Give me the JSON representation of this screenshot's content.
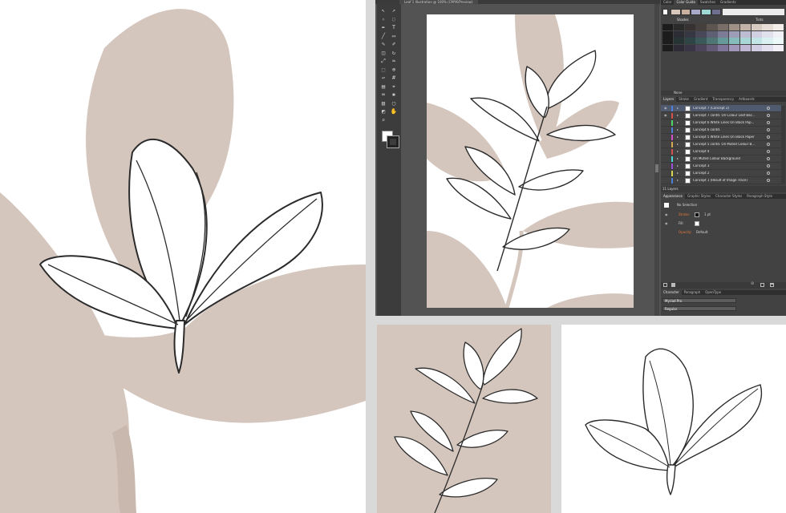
{
  "colors": {
    "beige": "#d5c6bd",
    "line": "#2b2b2b",
    "panel_bg": "#424242",
    "canvas_bg": "#535353",
    "selected_row": "#4f5a6e",
    "stroke_label": "#e07a3a"
  },
  "illustrator": {
    "document_tab": "Leaf 1 Illustration @ 100% (CMYK/Preview)",
    "tools": [
      "selection-tool",
      "direct-selection-tool",
      "magic-wand-tool",
      "lasso-tool",
      "pen-tool",
      "type-tool",
      "line-tool",
      "rectangle-tool",
      "paintbrush-tool",
      "pencil-tool",
      "eraser-tool",
      "rotate-tool",
      "scale-tool",
      "width-tool",
      "free-transform-tool",
      "shape-builder-tool",
      "perspective-tool",
      "mesh-tool",
      "gradient-tool",
      "eyedropper-tool",
      "blend-tool",
      "symbol-sprayer-tool",
      "column-graph-tool",
      "artboard-tool",
      "slice-tool",
      "hand-tool",
      "zoom-tool"
    ]
  },
  "color_guide": {
    "tabs": [
      "Color",
      "Color Guide",
      "Swatches",
      "Gradients"
    ],
    "active_tab": "Color Guide",
    "shades_label": "Shades",
    "tints_label": "Tints",
    "footer_label": "None",
    "strip_colors": [
      "#ffffff",
      "#d7c7bd",
      "#c9b09f",
      "#a9a9c9",
      "#9fd6d6",
      "#6f6f8f"
    ],
    "grid_columns": [
      "#3d3d3d",
      "#4a4543",
      "#5a524e",
      "#6b625c",
      "#8a7f77",
      "#a89e96",
      "#c7bdb5",
      "#d9d0c9",
      "#e6dfd9",
      "#f0ebe7"
    ],
    "grid_rows": [
      [
        "#2a2a2a",
        "#353231",
        "#45403d",
        "#5d5550",
        "#7a6f68",
        "#a09186",
        "#c2b3a8",
        "#d7cac1",
        "#e6ddd6",
        "#f3eee9"
      ],
      [
        "#2c2c34",
        "#373744",
        "#484858",
        "#5f5f74",
        "#7c7c96",
        "#9d9db7",
        "#bcbcd2",
        "#d0d0e2",
        "#e1e1ee",
        "#f0f0f7"
      ],
      [
        "#263434",
        "#2f4444",
        "#3c5959",
        "#4f7575",
        "#669999",
        "#86bcbc",
        "#a9d6d6",
        "#c4e5e5",
        "#dbf0f0",
        "#edf8f8"
      ],
      [
        "#2e2a36",
        "#3a3546",
        "#4b445b",
        "#625a77",
        "#7f759a",
        "#a097bb",
        "#bfb7d4",
        "#d3cde3",
        "#e4dfef",
        "#f2eff7"
      ]
    ]
  },
  "layers": {
    "tabs": [
      "Layers",
      "Stroke",
      "Gradient",
      "Transparency",
      "Artboards"
    ],
    "active_tab": "Layers",
    "items": [
      {
        "name": "Concept 7 (Concept 2)",
        "color": "#4f7fd6",
        "selected": true
      },
      {
        "name": "Concept 7 contd. On Colour Leaf Bac...",
        "color": "#d64f4f",
        "selected": false
      },
      {
        "name": "Concept 6 White Lines On Black Pap...",
        "color": "#4fd66a",
        "selected": false
      },
      {
        "name": "Concept 6 contd.",
        "color": "#4f7fd6",
        "selected": false
      },
      {
        "name": "Concept 5 White Lines On Black Paper",
        "color": "#d64fc9",
        "selected": false
      },
      {
        "name": "Concept 5 contd. On Muted Colour B...",
        "color": "#d6a84f",
        "selected": false
      },
      {
        "name": "Concept 4",
        "color": "#d64f4f",
        "selected": false
      },
      {
        "name": "On Muted Colour Background",
        "color": "#4fd6d6",
        "selected": false
      },
      {
        "name": "Concept 3",
        "color": "#9a4fd6",
        "selected": false
      },
      {
        "name": "Concept 2",
        "color": "#d6d64f",
        "selected": false
      },
      {
        "name": "Concept 1 (Result of Image Trace)",
        "color": "#4f7fd6",
        "selected": false
      }
    ],
    "count_label": "11 Layers"
  },
  "appearance": {
    "tabs": [
      "Appearance",
      "Graphic Styles",
      "Character Styles",
      "Paragraph Style"
    ],
    "active_tab": "Appearance",
    "selection_label": "No Selection",
    "stroke_label": "Stroke:",
    "stroke_value": "1 pt",
    "fill_label": "Fill:",
    "opacity_label": "Opacity:",
    "opacity_value": "Default"
  },
  "character": {
    "tabs": [
      "Character",
      "Paragraph",
      "OpenType"
    ],
    "active_tab": "Character",
    "font_family": "Myriad Pro",
    "font_style": "Regular"
  }
}
